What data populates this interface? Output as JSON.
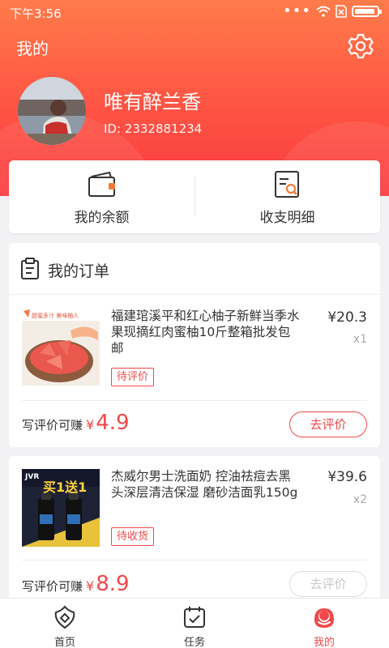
{
  "status_bar": {
    "time": "下午3:56",
    "icons": [
      "signal-dots-icon",
      "wifi-icon",
      "sim-icon",
      "battery-icon"
    ]
  },
  "header": {
    "title": "我的",
    "settings_icon": "gear-icon"
  },
  "profile": {
    "name": "唯有醉兰香",
    "id_text": "ID: 2332881234"
  },
  "balance": [
    {
      "label": "我的余额",
      "icon": "wallet-icon"
    },
    {
      "label": "收支明细",
      "icon": "bill-search-icon"
    }
  ],
  "orders": {
    "title": "我的订单",
    "items": [
      {
        "name": "福建琯溪平和红心柚子新鲜当季水果现摘红肉蜜柚10斤整箱批发包邮",
        "price": "¥20.3",
        "qty": "x1",
        "status": "待评价",
        "earn_label": "写评价可赚",
        "currency": "¥",
        "earn_amount": "4.9",
        "button": "去评价",
        "button_enabled": true,
        "thumb_banner": "甜蜜多汁 美味柚人"
      },
      {
        "name": "杰威尔男士洗面奶 控油祛痘去黑头深层清洁保湿 磨砂洁面乳150g",
        "price": "¥39.6",
        "qty": "x2",
        "status": "待收货",
        "earn_label": "写评价可赚",
        "currency": "¥",
        "earn_amount": "8.9",
        "button": "去评价",
        "button_enabled": false,
        "thumb_banner": "买1送1"
      }
    ]
  },
  "tabbar": [
    {
      "label": "首页",
      "icon": "home-icon",
      "active": false
    },
    {
      "label": "任务",
      "icon": "calendar-check-icon",
      "active": false
    },
    {
      "label": "我的",
      "icon": "profile-icon",
      "active": true
    }
  ],
  "colors": {
    "accent": "#f0484a",
    "header_top": "#ff7b4a",
    "header_bottom": "#fa3a3f",
    "background": "#f2f2f4"
  }
}
